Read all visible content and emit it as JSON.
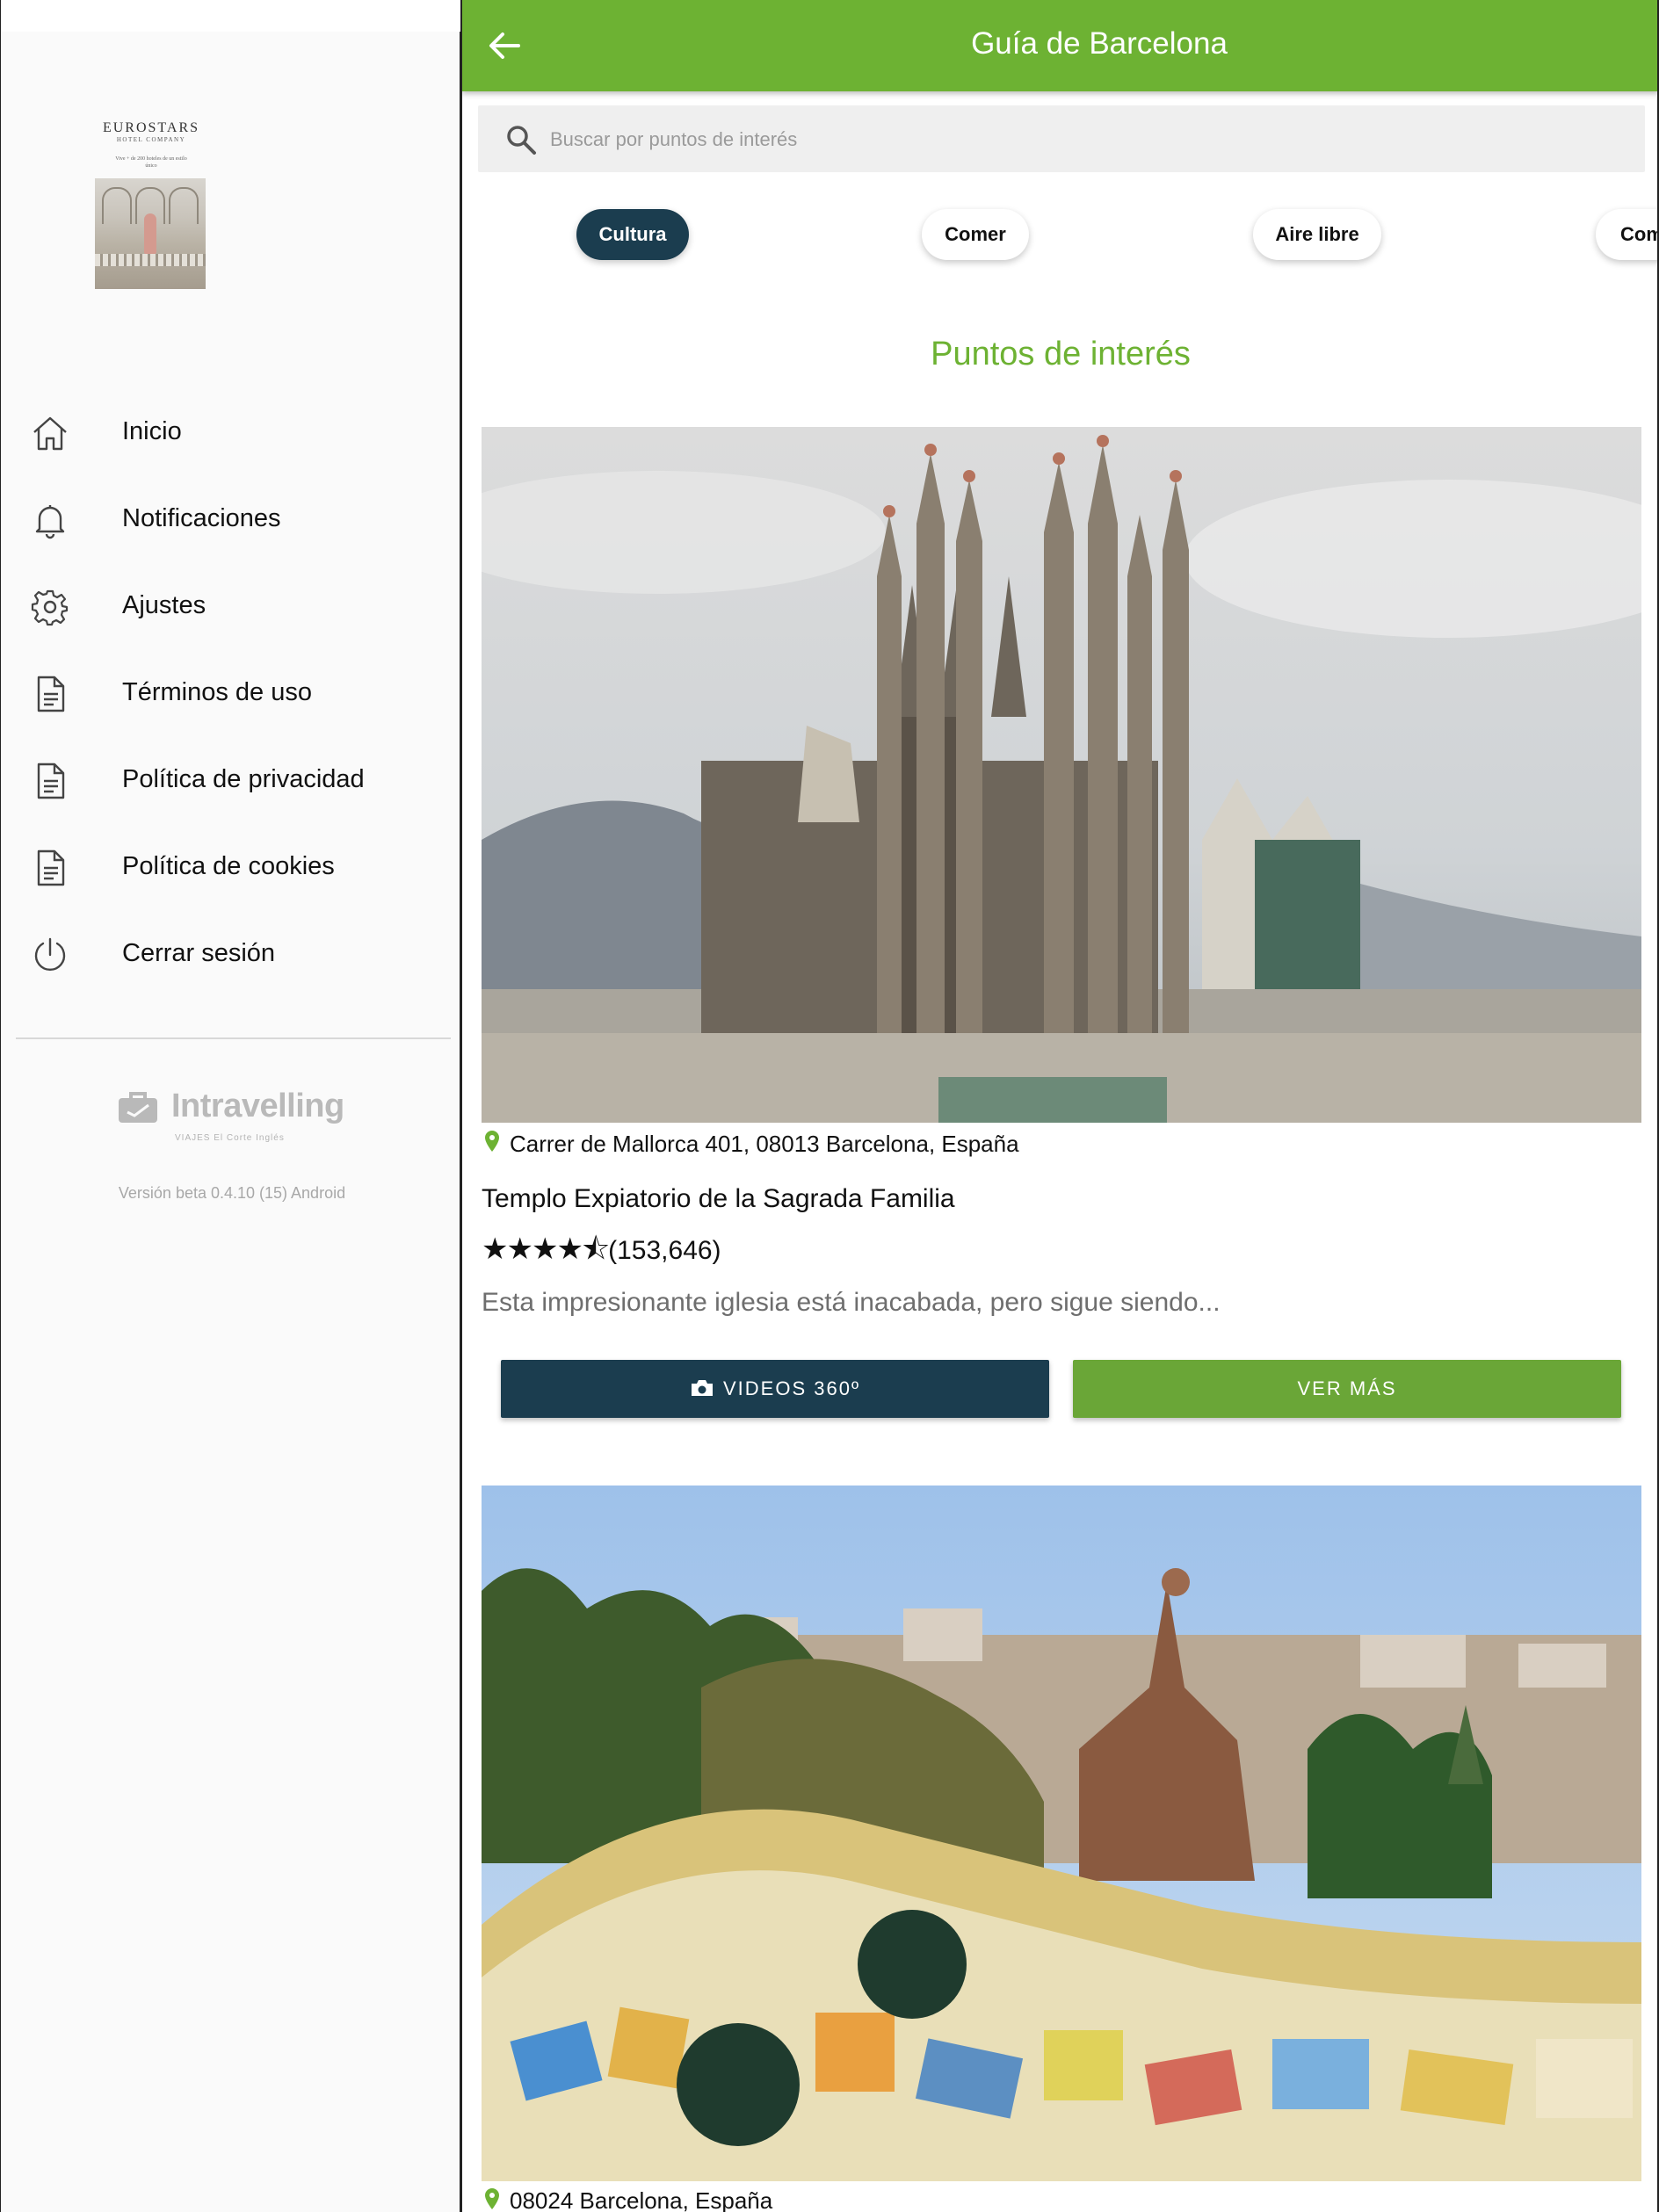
{
  "drawer": {
    "hotel_logo": {
      "brand": "EUROSTARS",
      "sub": "HOTEL COMPANY",
      "tagline": "Vive + de 200 hoteles de un estilo único"
    },
    "menu": [
      {
        "label": "Inicio",
        "icon": "home-icon"
      },
      {
        "label": "Notificaciones",
        "icon": "bell-icon"
      },
      {
        "label": "Ajustes",
        "icon": "gear-icon"
      },
      {
        "label": "Términos de uso",
        "icon": "document-icon"
      },
      {
        "label": "Política de privacidad",
        "icon": "document-icon"
      },
      {
        "label": "Política de cookies",
        "icon": "document-icon"
      },
      {
        "label": "Cerrar sesión",
        "icon": "power-icon"
      }
    ],
    "provider": {
      "name": "Intravelling",
      "sub": "VIAJES El Corte Inglés"
    },
    "version": "Versión beta 0.4.10 (15) Android"
  },
  "appbar": {
    "title": "Guía de Barcelona",
    "back_icon": "arrow-left-icon"
  },
  "search": {
    "placeholder": "Buscar por puntos de interés",
    "value": ""
  },
  "chips": [
    {
      "label": "Cultura",
      "active": true
    },
    {
      "label": "Comer",
      "active": false
    },
    {
      "label": "Aire libre",
      "active": false
    },
    {
      "label": "Com",
      "active": false
    }
  ],
  "section_title": "Puntos de interés",
  "pois": [
    {
      "address": "Carrer de Mallorca 401, 08013 Barcelona, España",
      "name": "Templo Expiatorio de la Sagrada Familia",
      "stars": "★★★★⯪",
      "rating_value": 4.5,
      "reviews": "(153,646)",
      "description": "Esta impresionante iglesia está inacabada, pero sigue siendo...",
      "btn_videos": "VIDEOS 360º",
      "btn_more": "VER MÁS"
    },
    {
      "address": "08024 Barcelona, España"
    }
  ],
  "colors": {
    "primary_green": "#6db233",
    "dark_blue": "#1b3d4f",
    "button_green": "#6aa637"
  }
}
